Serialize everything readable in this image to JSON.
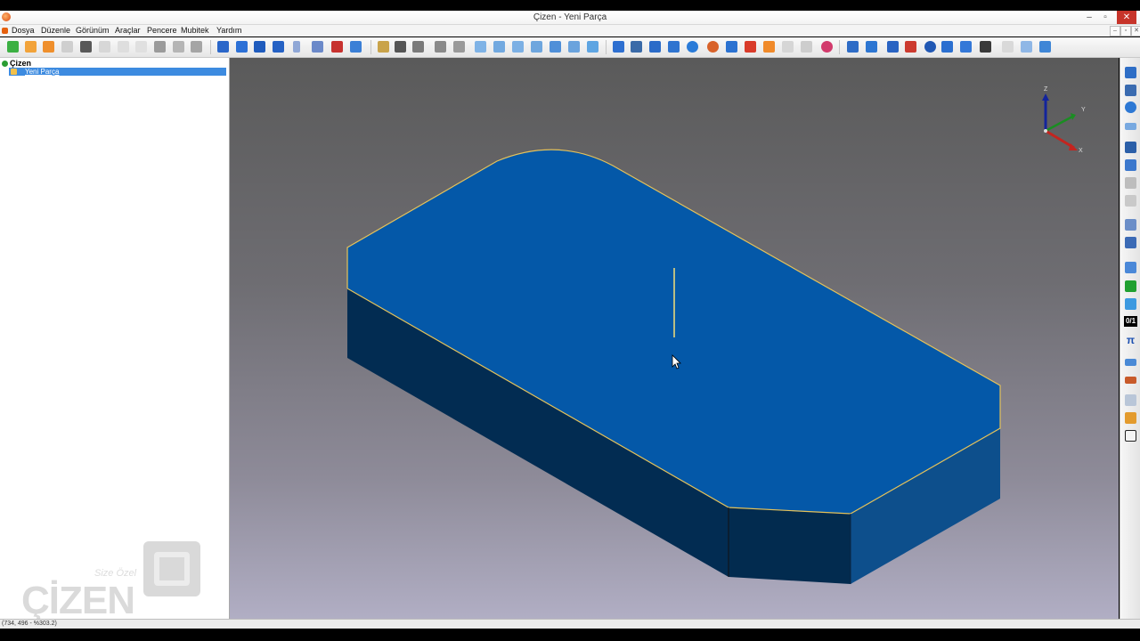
{
  "window": {
    "title": "Çizen - Yeni Parça",
    "minimize": "–",
    "maximize": "▫",
    "close": "✕"
  },
  "menu": {
    "items": [
      "Dosya",
      "Düzenle",
      "Görünüm",
      "Araçlar",
      "Pencere",
      "Mubitek",
      "Yardım"
    ],
    "mdi_minimize": "–",
    "mdi_restore": "▫",
    "mdi_close": "✕"
  },
  "tree": {
    "root": "Çizen",
    "child": "Yeni Parça"
  },
  "viewport": {
    "axes": {
      "z": "Z",
      "y": "Y",
      "x": "X"
    },
    "colors": {
      "top_face": "#0458a8",
      "front_face": "#022c52",
      "side_face": "#0d4f8c",
      "edge": "#e5c25a"
    }
  },
  "right_toolbar": {
    "label_01": "0/1",
    "label_pi": "π"
  },
  "status": {
    "coords": "(734, 496 - %303.2)"
  },
  "watermark": {
    "brand": "ÇİZEN",
    "tagline": "Size Özel"
  }
}
